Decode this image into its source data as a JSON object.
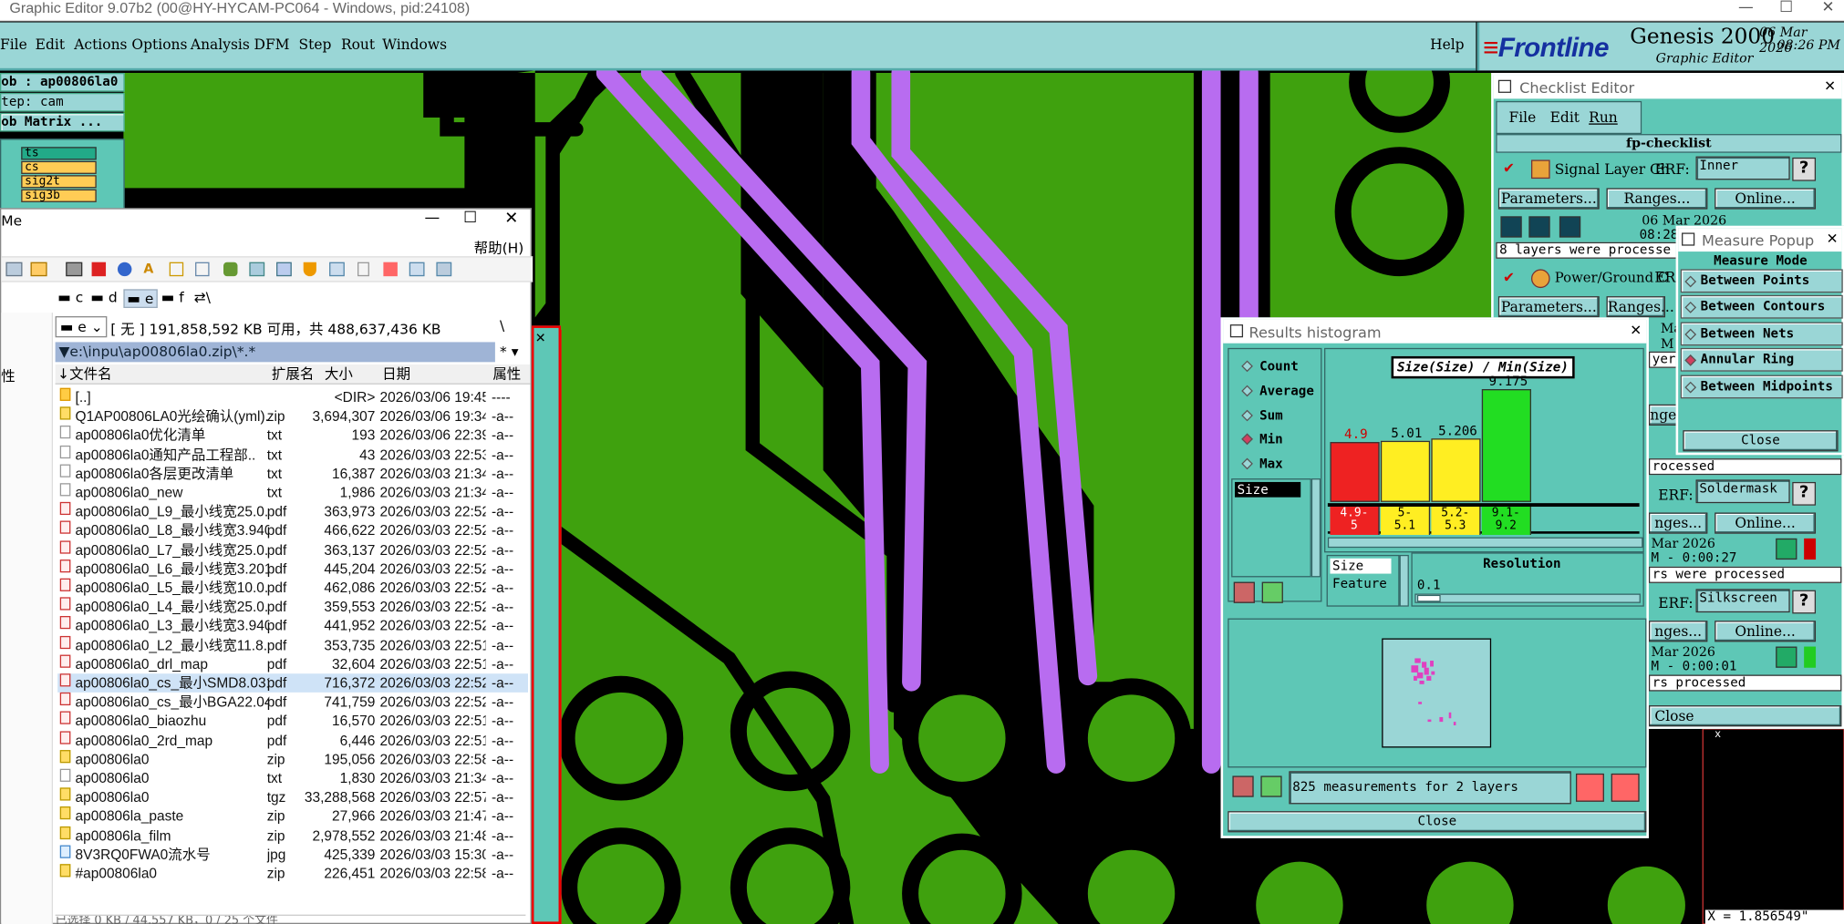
{
  "window": {
    "title": "Graphic Editor 9.07b2 (00@HY-HYCAM-PC064 - Windows, pid:24108)",
    "minimize": "—",
    "maximize": "☐",
    "close": "✕"
  },
  "menu": {
    "items": [
      "File",
      "Edit",
      "Actions",
      "Options",
      "Analysis",
      "DFM",
      "Step",
      "Rout",
      "Windows"
    ],
    "help": "Help"
  },
  "brand": {
    "logo": "Frontline",
    "product": "Genesis 2000",
    "subtitle": "Graphic Editor",
    "date": "06 Mar 2026",
    "time": "08:26 PM"
  },
  "job": {
    "job": "ob : ap00806la0",
    "step": "tep: cam",
    "matrix": "ob Matrix ...",
    "layers": [
      {
        "name": "ts",
        "color": "#22aa88"
      },
      {
        "name": "cs",
        "color": "#ffcc55"
      },
      {
        "name": "sig2t",
        "color": "#ffcc55"
      },
      {
        "name": "sig3b",
        "color": "#ffcc55"
      }
    ]
  },
  "file_manager": {
    "title": "Me",
    "help_menu": "帮助(H)",
    "drives": [
      "c",
      "d",
      "e",
      "f",
      "\\"
    ],
    "drive_select": "e",
    "disk_info": "[ 无 ]  191,858,592 KB 可用，共 488,637,436 KB",
    "path": "e:\\inpu\\ap00806la0.zip\\*.*",
    "columns": [
      "↓文件名",
      "扩展名",
      "大小",
      "日期",
      "属性"
    ],
    "left_col": "性",
    "rows": [
      {
        "name": "[..]",
        "ext": "",
        "size": "<DIR>",
        "date": "2026/03/06 19:45",
        "attr": "----",
        "icon": "fold"
      },
      {
        "name": "Q1AP00806LA0光绘确认(yml)..",
        "ext": "zip",
        "size": "3,694,307",
        "date": "2026/03/06 19:34",
        "attr": "-a--",
        "icon": "zip"
      },
      {
        "name": "ap00806la0优化清单",
        "ext": "txt",
        "size": "193",
        "date": "2026/03/06 22:39",
        "attr": "-a--",
        "icon": "txt"
      },
      {
        "name": "ap00806la0通知产品工程部..",
        "ext": "txt",
        "size": "43",
        "date": "2026/03/03 22:53",
        "attr": "-a--",
        "icon": "txt"
      },
      {
        "name": "ap00806la0各层更改清单",
        "ext": "txt",
        "size": "16,387",
        "date": "2026/03/03 21:34",
        "attr": "-a--",
        "icon": "txt"
      },
      {
        "name": "ap00806la0_new",
        "ext": "txt",
        "size": "1,986",
        "date": "2026/03/03 21:34",
        "attr": "-a--",
        "icon": "txt"
      },
      {
        "name": "ap00806la0_L9_最小线宽25.0..",
        "ext": "pdf",
        "size": "363,973",
        "date": "2026/03/03 22:52",
        "attr": "-a--",
        "icon": "pdf"
      },
      {
        "name": "ap00806la0_L8_最小线宽3.940",
        "ext": "pdf",
        "size": "466,622",
        "date": "2026/03/03 22:52",
        "attr": "-a--",
        "icon": "pdf"
      },
      {
        "name": "ap00806la0_L7_最小线宽25.0..",
        "ext": "pdf",
        "size": "363,137",
        "date": "2026/03/03 22:52",
        "attr": "-a--",
        "icon": "pdf"
      },
      {
        "name": "ap00806la0_L6_最小线宽3.201",
        "ext": "pdf",
        "size": "445,204",
        "date": "2026/03/03 22:52",
        "attr": "-a--",
        "icon": "pdf"
      },
      {
        "name": "ap00806la0_L5_最小线宽10.0..",
        "ext": "pdf",
        "size": "462,086",
        "date": "2026/03/03 22:52",
        "attr": "-a--",
        "icon": "pdf"
      },
      {
        "name": "ap00806la0_L4_最小线宽25.0..",
        "ext": "pdf",
        "size": "359,553",
        "date": "2026/03/03 22:52",
        "attr": "-a--",
        "icon": "pdf"
      },
      {
        "name": "ap00806la0_L3_最小线宽3.940",
        "ext": "pdf",
        "size": "441,952",
        "date": "2026/03/03 22:52",
        "attr": "-a--",
        "icon": "pdf"
      },
      {
        "name": "ap00806la0_L2_最小线宽11.8..",
        "ext": "pdf",
        "size": "353,735",
        "date": "2026/03/03 22:51",
        "attr": "-a--",
        "icon": "pdf"
      },
      {
        "name": "ap00806la0_drl_map",
        "ext": "pdf",
        "size": "32,604",
        "date": "2026/03/03 22:51",
        "attr": "-a--",
        "icon": "pdf"
      },
      {
        "name": "ap00806la0_cs_最小SMD8.031",
        "ext": "pdf",
        "size": "716,372",
        "date": "2026/03/03 22:52",
        "attr": "-a--",
        "icon": "pdf",
        "selected": true
      },
      {
        "name": "ap00806la0_cs_最小BGA22.047",
        "ext": "pdf",
        "size": "741,759",
        "date": "2026/03/03 22:52",
        "attr": "-a--",
        "icon": "pdf"
      },
      {
        "name": "ap00806la0_biaozhu",
        "ext": "pdf",
        "size": "16,570",
        "date": "2026/03/03 22:51",
        "attr": "-a--",
        "icon": "pdf"
      },
      {
        "name": "ap00806la0_2rd_map",
        "ext": "pdf",
        "size": "6,446",
        "date": "2026/03/03 22:51",
        "attr": "-a--",
        "icon": "pdf"
      },
      {
        "name": "ap00806la0",
        "ext": "zip",
        "size": "195,056",
        "date": "2026/03/03 22:58",
        "attr": "-a--",
        "icon": "zip"
      },
      {
        "name": "ap00806la0",
        "ext": "txt",
        "size": "1,830",
        "date": "2026/03/03 21:34",
        "attr": "-a--",
        "icon": "txt"
      },
      {
        "name": "ap00806la0",
        "ext": "tgz",
        "size": "33,288,568",
        "date": "2026/03/03 22:57",
        "attr": "-a--",
        "icon": "zip"
      },
      {
        "name": "ap00806la_paste",
        "ext": "zip",
        "size": "27,966",
        "date": "2026/03/03 21:47",
        "attr": "-a--",
        "icon": "zip"
      },
      {
        "name": "ap00806la_film",
        "ext": "zip",
        "size": "2,978,552",
        "date": "2026/03/03 21:48",
        "attr": "-a--",
        "icon": "zip"
      },
      {
        "name": "8V3RQ0FWA0流水号",
        "ext": "jpg",
        "size": "425,339",
        "date": "2026/03/03 15:30",
        "attr": "-a--",
        "icon": "jpg"
      },
      {
        "name": "#ap00806la0",
        "ext": "zip",
        "size": "226,451",
        "date": "2026/03/03 22:58",
        "attr": "-a--",
        "icon": "zip"
      }
    ]
  },
  "checklist": {
    "title": "Checklist Editor",
    "menu": [
      "File",
      "Edit",
      "Run"
    ],
    "name": "fp-checklist",
    "items": [
      {
        "name": "Signal Layer Ch",
        "erf": "ERF:",
        "erf_value": "Inner",
        "buttons": [
          "Parameters...",
          "Ranges...",
          "Online..."
        ],
        "date": "06 Mar 2026",
        "time": "08:28 PM",
        "status": "8 layers were processe"
      },
      {
        "name": "Power/Ground C",
        "erf": "ERF",
        "buttons": [
          "Parameters...",
          "Ranges..."
        ],
        "date": "Mar",
        "time": "M -",
        "status": "yers"
      }
    ],
    "right_fragments": {
      "b1": "nges.",
      "s1": "rocessed",
      "erf_sm": "ERF:",
      "sm": "Soldermask",
      "rng2": "nges...",
      "onl2": "Online...",
      "d2": "Mar 2026",
      "t2": "M - 0:00:27",
      "st2": "rs were processed",
      "erf_ss": "ERF:",
      "ss": "Silkscreen",
      "rng3": "nges...",
      "onl3": "Online...",
      "d3": "Mar 2026",
      "t3": "M - 0:00:01",
      "st3": "rs processed",
      "close": "Close"
    }
  },
  "measure_popup": {
    "title": "Measure Popup",
    "heading": "Measure Mode",
    "items": [
      {
        "label": "Between Points",
        "on": false
      },
      {
        "label": "Between Contours",
        "on": false
      },
      {
        "label": "Between Nets",
        "on": false
      },
      {
        "label": "Annular Ring",
        "on": true
      },
      {
        "label": "Between Midpoints",
        "on": false
      }
    ],
    "close": "Close"
  },
  "histogram": {
    "title": "Results histogram",
    "options": [
      {
        "label": "Count",
        "on": false
      },
      {
        "label": "Average",
        "on": false
      },
      {
        "label": "Sum",
        "on": false
      },
      {
        "label": "Min",
        "on": true
      },
      {
        "label": "Max",
        "on": false
      }
    ],
    "list_item": "Size",
    "chart_title": "Size(Size) / Min(Size)",
    "bars": [
      {
        "value": "4.9",
        "level": 0.53,
        "color": "#ee2222",
        "range": "4.9-\n5"
      },
      {
        "value": "5.01",
        "level": 0.546,
        "color": "#ffee22",
        "range": "5-\n5.1"
      },
      {
        "value": "5.206",
        "level": 0.567,
        "color": "#ffee22",
        "range": "5.2-\n5.3"
      },
      {
        "value": "9.175",
        "level": 1.0,
        "color": "#22dd22",
        "range": "9.1-\n9.2"
      }
    ],
    "axis_list": [
      "Size",
      "Feature"
    ],
    "resolution_label": "Resolution",
    "resolution_value": "0.1",
    "summary": "825 measurements for 2 layers",
    "close": "Close"
  },
  "coord": "X = 1.856549\""
}
